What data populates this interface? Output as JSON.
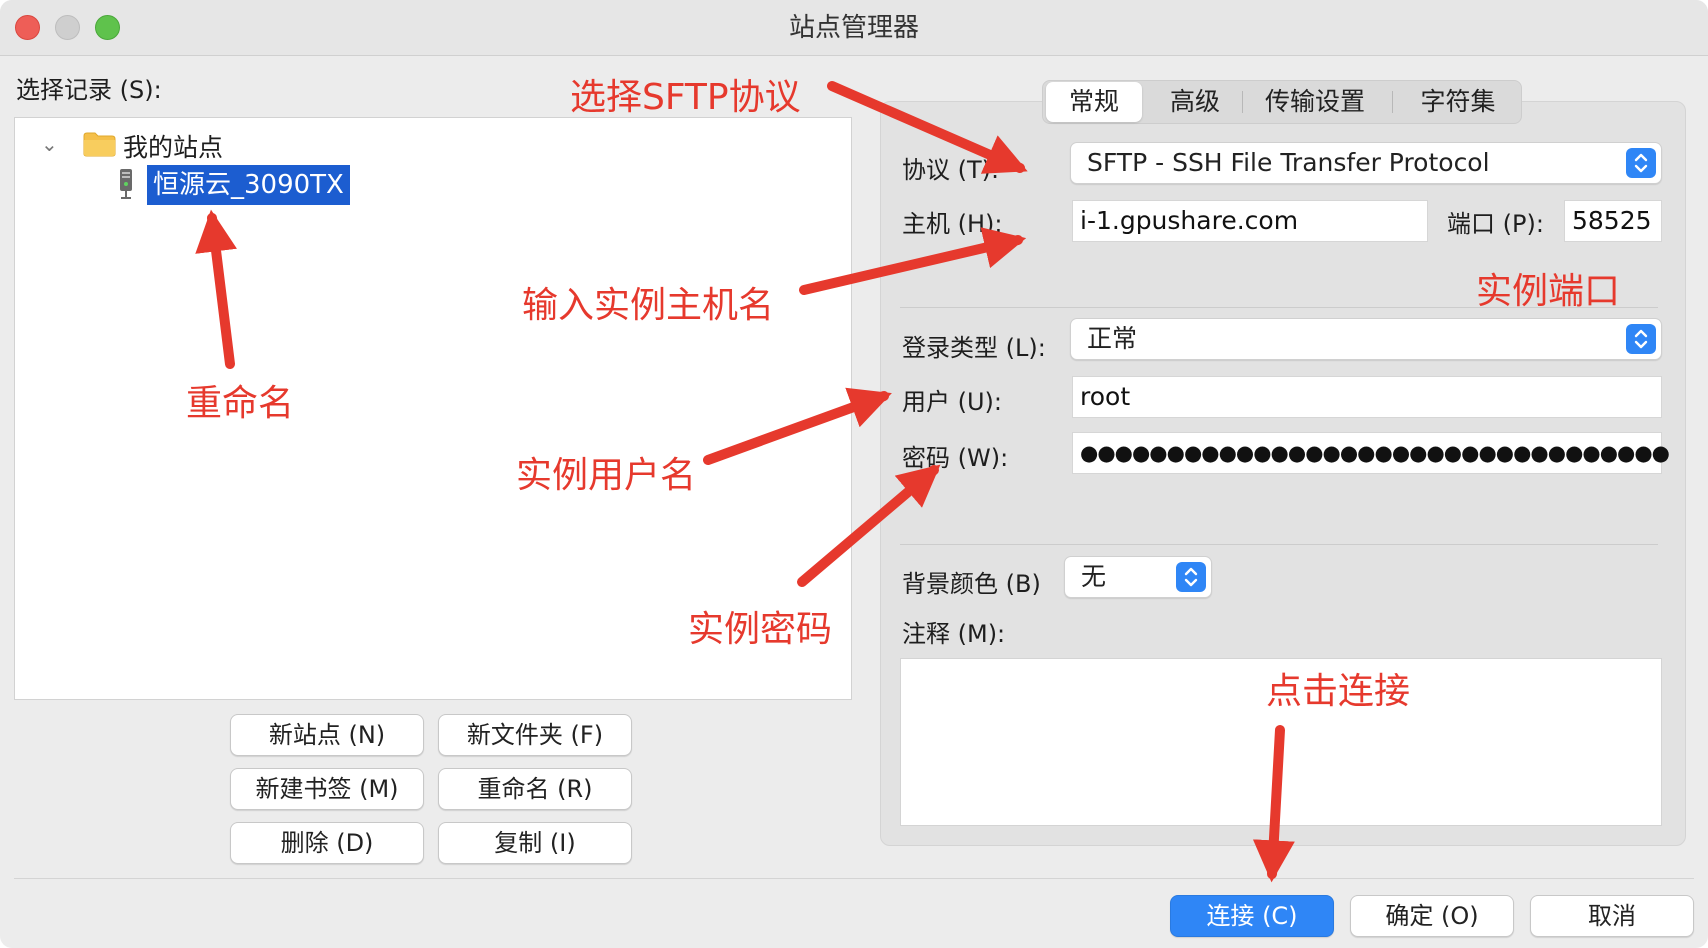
{
  "window": {
    "title": "站点管理器"
  },
  "left": {
    "select_label": "选择记录 (S):",
    "tree": {
      "folder": "我的站点",
      "site": "恒源云_3090TX"
    },
    "buttons": {
      "new_site": "新站点 (N)",
      "new_folder": "新文件夹 (F)",
      "new_bookmark": "新建书签 (M)",
      "rename": "重命名 (R)",
      "delete": "删除 (D)",
      "copy": "复制 (I)"
    }
  },
  "tabs": [
    "常规",
    "高级",
    "传输设置",
    "字符集"
  ],
  "form": {
    "protocol_label": "协议 (T):",
    "protocol_value": "SFTP - SSH File Transfer Protocol",
    "host_label": "主机 (H):",
    "host_value": "i-1.gpushare.com",
    "port_label": "端口 (P):",
    "port_value": "58525",
    "logon_label": "登录类型 (L):",
    "logon_value": "正常",
    "user_label": "用户 (U):",
    "user_value": "root",
    "password_label": "密码 (W):",
    "password_value": "●●●●●●●●●●●●●●●●●●●●●●●●●●●●●●●●●●",
    "bg_label": "背景颜色 (B)",
    "bg_value": "无",
    "notes_label": "注释 (M):"
  },
  "footer": {
    "connect": "连接 (C)",
    "ok": "确定 (O)",
    "cancel": "取消"
  },
  "annotations": {
    "protocol": "选择SFTP协议",
    "rename": "重命名",
    "host": "输入实例主机名",
    "port": "实例端口",
    "user": "实例用户名",
    "password": "实例密码",
    "connect": "点击连接"
  },
  "colors": {
    "annotation": "#e6392d",
    "accent": "#2f86f6",
    "selection": "#1c5dd0"
  }
}
